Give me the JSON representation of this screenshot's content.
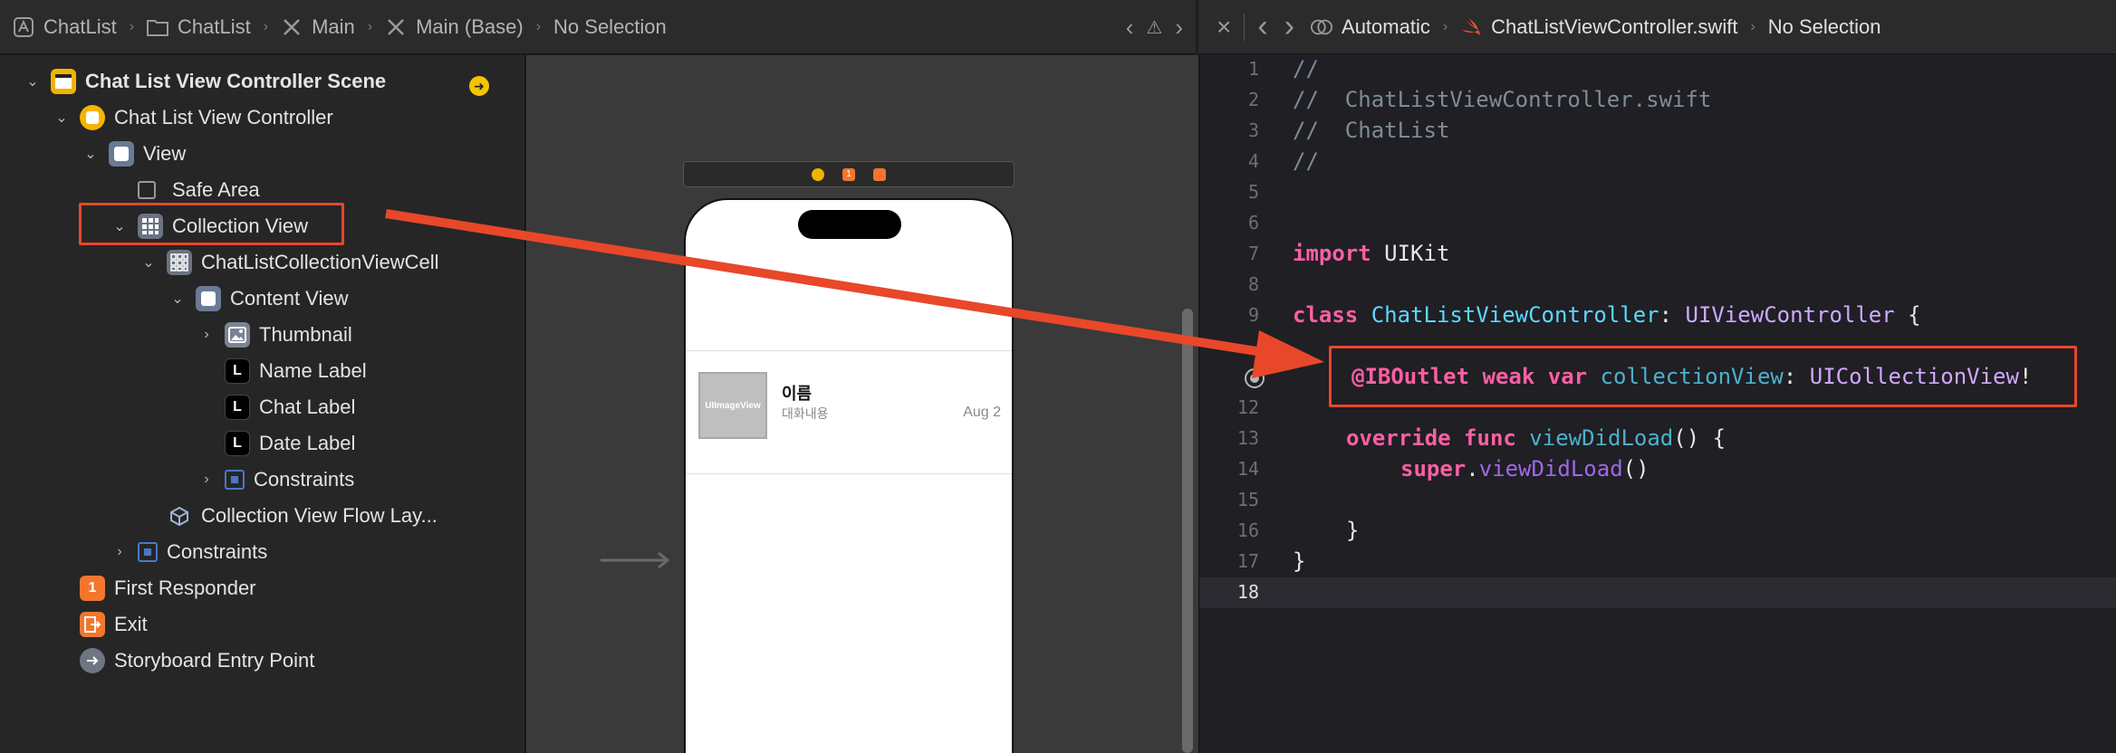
{
  "left_jumpbar": {
    "items": [
      "ChatList",
      "ChatList",
      "Main",
      "Main (Base)",
      "No Selection"
    ]
  },
  "right_jumpbar": {
    "items": [
      "Automatic",
      "ChatListViewController.swift",
      "No Selection"
    ]
  },
  "outline": {
    "scene": "Chat List View Controller Scene",
    "controller": "Chat List View Controller",
    "view": "View",
    "safe_area": "Safe Area",
    "collection_view": "Collection View",
    "cell": "ChatListCollectionViewCell",
    "content_view": "Content View",
    "thumbnail": "Thumbnail",
    "name_label": "Name Label",
    "chat_label": "Chat Label",
    "date_label": "Date Label",
    "constraints_inner": "Constraints",
    "flow_layout": "Collection View Flow Lay...",
    "constraints_outer": "Constraints",
    "first_responder": "First Responder",
    "exit": "Exit",
    "entry_point": "Storyboard Entry Point",
    "label_icon_letter": "L",
    "first_responder_icon_letter": "1"
  },
  "canvas": {
    "thumbnail_text": "UIImageView",
    "name": "이름",
    "chat": "대화내용",
    "date": "Aug 2",
    "dock_badge": "1"
  },
  "editor": {
    "line_numbers": [
      "1",
      "2",
      "3",
      "4",
      "5",
      "6",
      "7",
      "8",
      "9",
      "",
      "12",
      "13",
      "14",
      "15",
      "16",
      "17",
      "18"
    ],
    "current_line": "18",
    "lines": {
      "l1": "//",
      "l2": "//  ChatListViewController.swift",
      "l3": "//  ChatList",
      "l4": "//",
      "l7_kw": "import",
      "l7_ty": "UIKit",
      "l9_kw": "class",
      "l9_name": "ChatListViewController",
      "l9_colon": ": ",
      "l9_super": "UIViewController",
      "l9_brace": " {",
      "l11_attr": "@IBOutlet",
      "l11_kw1": "weak",
      "l11_kw2": "var",
      "l11_name": "collectionView",
      "l11_colon": ": ",
      "l11_type": "UICollectionView",
      "l11_bang": "!",
      "l13_kw1": "override",
      "l13_kw2": "func",
      "l13_name": "viewDidLoad",
      "l13_rest": "() {",
      "l14_kw": "super",
      "l14_dot": ".",
      "l14_call": "viewDidLoad",
      "l14_rest": "()",
      "l16": "}",
      "l17": "}"
    }
  },
  "colors": {
    "highlight": "#e8472a",
    "keyword": "#fc5fa3",
    "comment": "#7f8c98"
  }
}
